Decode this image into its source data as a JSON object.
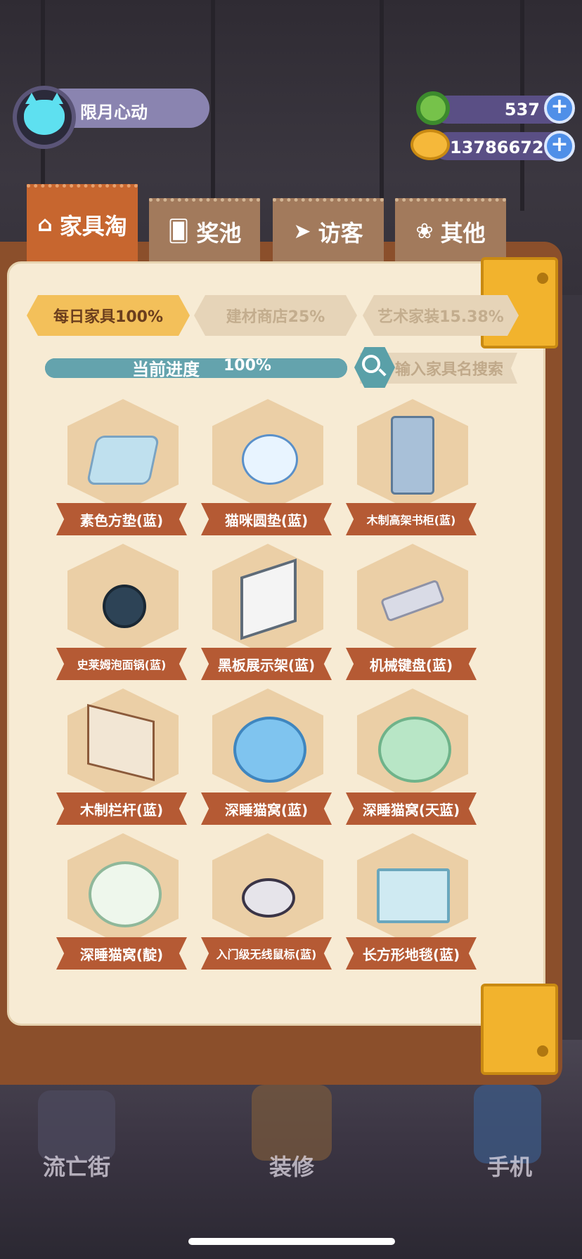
{
  "profile": {
    "name": "限月心动"
  },
  "currency": [
    {
      "icon": "donut-coin-icon",
      "value": "537",
      "color": "#76c24a"
    },
    {
      "icon": "planet-coin-icon",
      "value": "13786672",
      "color": "#f5b83a"
    }
  ],
  "tabs": [
    {
      "label": "家具淘",
      "icon": "house-icon",
      "active": true
    },
    {
      "label": "奖池",
      "icon": "card-icon",
      "active": false
    },
    {
      "label": "访客",
      "icon": "paper-plane-icon",
      "active": false
    },
    {
      "label": "其他",
      "icon": "paw-icon",
      "active": false
    }
  ],
  "filters": [
    {
      "label": "每日家具100%",
      "active": true
    },
    {
      "label": "建材商店25%",
      "active": false
    },
    {
      "label": "艺术家装15.38%",
      "active": false
    }
  ],
  "progress": {
    "label": "当前进度",
    "value": "100%",
    "fraction": 1.0
  },
  "search": {
    "placeholder": "输入家具名搜索"
  },
  "items": [
    {
      "name": "素色方垫(蓝)",
      "icon": "square-cushion-icon"
    },
    {
      "name": "猫咪圆垫(蓝)",
      "icon": "cat-cushion-icon"
    },
    {
      "name": "木制高架书柜(蓝)",
      "icon": "bookshelf-icon"
    },
    {
      "name": "史莱姆泡面锅(蓝)",
      "icon": "slime-pot-icon"
    },
    {
      "name": "黑板展示架(蓝)",
      "icon": "blackboard-stand-icon"
    },
    {
      "name": "机械键盘(蓝)",
      "icon": "keyboard-icon"
    },
    {
      "name": "木制栏杆(蓝)",
      "icon": "wooden-railing-icon"
    },
    {
      "name": "深睡猫窝(蓝)",
      "icon": "cat-bed-blue-icon"
    },
    {
      "name": "深睡猫窝(天蓝)",
      "icon": "cat-bed-skyblue-icon"
    },
    {
      "name": "深睡猫窝(靛)",
      "icon": "cat-bed-indigo-icon"
    },
    {
      "name": "入门级无线鼠标(蓝)",
      "icon": "wireless-mouse-icon"
    },
    {
      "name": "长方形地毯(蓝)",
      "icon": "rectangle-rug-icon"
    }
  ],
  "bottom_nav": [
    {
      "label": "流亡街",
      "icon": "street-icon"
    },
    {
      "label": "装修",
      "icon": "decorate-icon"
    },
    {
      "label": "手机",
      "icon": "phone-icon"
    }
  ]
}
